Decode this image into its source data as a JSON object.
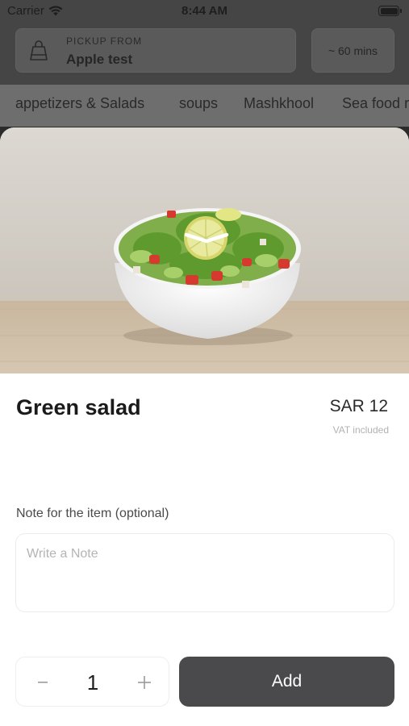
{
  "status_bar": {
    "carrier": "Carrier",
    "time": "8:44 AM",
    "wifi_icon": "wifi-icon",
    "battery_icon": "battery-icon"
  },
  "header": {
    "pickup_label": "PICKUP FROM",
    "pickup_value": "Apple test",
    "bag_icon": "shopping-bag-icon",
    "duration": "~ 60 mins"
  },
  "categories": [
    "appetizers &  Salads",
    "soups",
    "Mashkhool",
    "Sea food r"
  ],
  "item": {
    "name": "Green salad",
    "price": "SAR 12",
    "vat_note": "VAT included",
    "note_label": "Note for the item (optional)",
    "note_placeholder": "Write a Note",
    "note_value": "",
    "quantity": "1",
    "add_label": "Add"
  },
  "colors": {
    "primary_button": "#4a4a4c",
    "overlay": "#454545"
  }
}
